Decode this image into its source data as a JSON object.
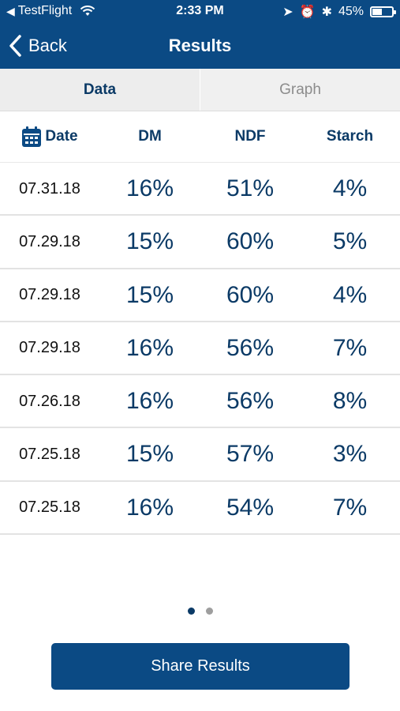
{
  "status_bar": {
    "app_back": "TestFlight",
    "time": "2:33 PM",
    "battery": "45%",
    "battery_level": 0.45
  },
  "nav": {
    "back_label": "Back",
    "title": "Results"
  },
  "tabs": [
    {
      "label": "Data",
      "active": true
    },
    {
      "label": "Graph",
      "active": false
    }
  ],
  "table": {
    "headers": {
      "date": "Date",
      "dm": "DM",
      "ndf": "NDF",
      "starch": "Starch"
    },
    "rows": [
      {
        "date": "07.31.18",
        "dm": "16%",
        "ndf": "51%",
        "starch": "4%"
      },
      {
        "date": "07.29.18",
        "dm": "15%",
        "ndf": "60%",
        "starch": "5%"
      },
      {
        "date": "07.29.18",
        "dm": "15%",
        "ndf": "60%",
        "starch": "4%"
      },
      {
        "date": "07.29.18",
        "dm": "16%",
        "ndf": "56%",
        "starch": "7%"
      },
      {
        "date": "07.26.18",
        "dm": "16%",
        "ndf": "56%",
        "starch": "8%"
      },
      {
        "date": "07.25.18",
        "dm": "15%",
        "ndf": "57%",
        "starch": "3%"
      },
      {
        "date": "07.25.18",
        "dm": "16%",
        "ndf": "54%",
        "starch": "7%"
      }
    ]
  },
  "pager": {
    "pages": 2,
    "current": 1
  },
  "share_button": "Share Results",
  "colors": {
    "brand": "#0b4a84",
    "text_dark_blue": "#0b3a66",
    "tab_bg": "#ededed"
  }
}
